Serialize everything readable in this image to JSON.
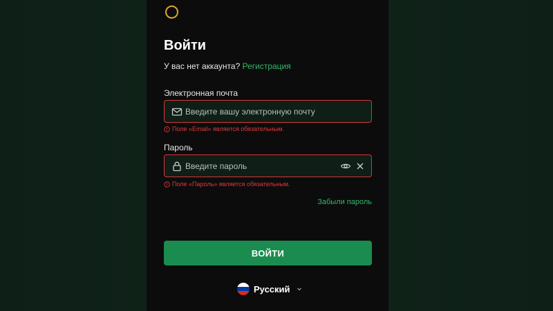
{
  "login": {
    "title": "Войти",
    "no_account_text": "У вас нет аккаунта?",
    "signup_link": "Регистрация",
    "email": {
      "label": "Электронная почта",
      "placeholder": "Введите вашу электронную почту",
      "value": "",
      "error": "Поле «Email» является обязательным."
    },
    "password": {
      "label": "Пароль",
      "placeholder": "Введите пароль",
      "value": "",
      "error": "Поле «Пароль» является обязательным."
    },
    "forgot_password": "Забыли пароль",
    "submit_label": "ВОЙТИ"
  },
  "language": {
    "selected": "Русский",
    "flag_colors": [
      "#ffffff",
      "#0039a6",
      "#d52b1e"
    ]
  },
  "colors": {
    "accent": "#33b86a",
    "button": "#1b8c4f",
    "error": "#e2383c",
    "logo": "#e2a72c"
  },
  "icons": {
    "logo": "circle-logo-icon",
    "email": "envelope-icon",
    "password": "lock-icon",
    "show_password": "eye-icon",
    "clear": "close-icon",
    "error": "alert-circle-icon",
    "language_dropdown": "chevron-down-icon"
  }
}
